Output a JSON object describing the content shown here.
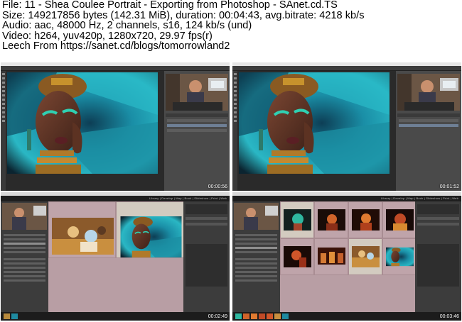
{
  "file_info": {
    "line1": "File: 11 - Shea Coulee Portrait - Exporting from Photoshop - SAnet.cd.TS",
    "line2": "Size: 149217856 bytes (142.31 MiB), duration: 00:04:43, avg.bitrate: 4218 kb/s",
    "line3": "Audio: aac, 48000 Hz, 2 channels, s16, 124 kb/s (und)",
    "line4": "Video: h264, yuv420p, 1280x720, 29.97 fps(r)",
    "line5": "Leech From https://sanet.cd/blogs/tomorrowland2"
  },
  "frames": [
    {
      "app": "Photoshop",
      "timestamp": "00:00:56"
    },
    {
      "app": "Photoshop",
      "timestamp": "00:01:52"
    },
    {
      "app": "Lightroom",
      "timestamp": "00:02:49"
    },
    {
      "app": "Lightroom",
      "timestamp": "00:03:46"
    }
  ],
  "lightroom": {
    "modules": "Library | Develop | Map | Book | Slideshow | Print | Web"
  },
  "colors": {
    "ps_background": "#2a2a2a",
    "lr_grid_background": "#b89ea4",
    "feather_teal": "#1fa3b4"
  }
}
